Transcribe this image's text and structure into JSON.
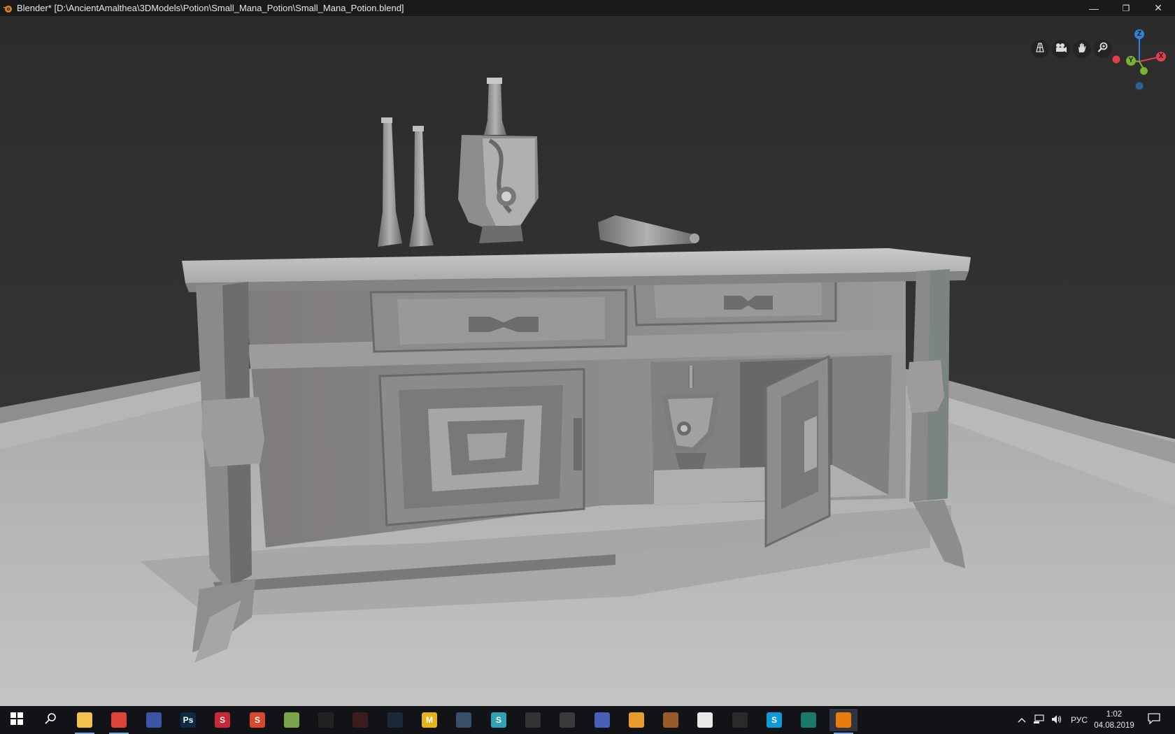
{
  "window": {
    "title": "Blender* [D:\\AncientAmalthea\\3DModels\\Potion\\Small_Mana_Potion\\Small_Mana_Potion.blend]",
    "minimize": "—",
    "restore": "❐",
    "close": "✕"
  },
  "viewport": {
    "nav_buttons": [
      {
        "name": "perspective-grid-icon"
      },
      {
        "name": "camera-icon"
      },
      {
        "name": "hand-pan-icon"
      },
      {
        "name": "zoom-magnifier-icon"
      }
    ],
    "gizmo": {
      "z_label": "Z",
      "y_label": "Y",
      "x_label": "X",
      "colors": {
        "x": "#e0404a",
        "y": "#7ab330",
        "z": "#2f82d8"
      }
    }
  },
  "taskbar": {
    "apps": [
      {
        "name": "file-explorer-icon",
        "glyph": "",
        "color": "#f2c14e"
      },
      {
        "name": "chrome-icon",
        "glyph": "",
        "color": "#db4437"
      },
      {
        "name": "app-icon-3",
        "glyph": "",
        "color": "#3955a3"
      },
      {
        "name": "photoshop-icon",
        "glyph": "Ps",
        "color": "#0a2a46"
      },
      {
        "name": "substance-painter-icon",
        "glyph": "S",
        "color": "#c9273a"
      },
      {
        "name": "substance-designer-icon",
        "glyph": "S",
        "color": "#d9482b"
      },
      {
        "name": "notepad-icon",
        "glyph": "",
        "color": "#7aa34a"
      },
      {
        "name": "unity-icon",
        "glyph": "",
        "color": "#222222"
      },
      {
        "name": "marmoset-icon",
        "glyph": "",
        "color": "#3a1c1c"
      },
      {
        "name": "steam-icon",
        "glyph": "",
        "color": "#1b2838"
      },
      {
        "name": "marvelous-icon",
        "glyph": "M",
        "color": "#e8b21a"
      },
      {
        "name": "app-icon-12",
        "glyph": "",
        "color": "#3a4e6a"
      },
      {
        "name": "substance-source-icon",
        "glyph": "S",
        "color": "#2fa3b5"
      },
      {
        "name": "app-icon-14",
        "glyph": "",
        "color": "#333333"
      },
      {
        "name": "app-icon-15",
        "glyph": "",
        "color": "#3a3a3a"
      },
      {
        "name": "app-icon-16",
        "glyph": "",
        "color": "#4a60b8"
      },
      {
        "name": "app-icon-17",
        "glyph": "",
        "color": "#e89a2a"
      },
      {
        "name": "app-icon-18",
        "glyph": "",
        "color": "#9a5a2a"
      },
      {
        "name": "app-icon-19",
        "glyph": "",
        "color": "#e8e8e8"
      },
      {
        "name": "obs-icon",
        "glyph": "",
        "color": "#2a2a2a"
      },
      {
        "name": "skype-icon",
        "glyph": "S",
        "color": "#0f9ad8"
      },
      {
        "name": "app-icon-22",
        "glyph": "",
        "color": "#1a7a6a"
      },
      {
        "name": "blender-icon",
        "glyph": "",
        "color": "#e87d0d"
      }
    ],
    "tray": {
      "language": "РУС",
      "time": "1:02",
      "date": "04.08.2019"
    }
  }
}
